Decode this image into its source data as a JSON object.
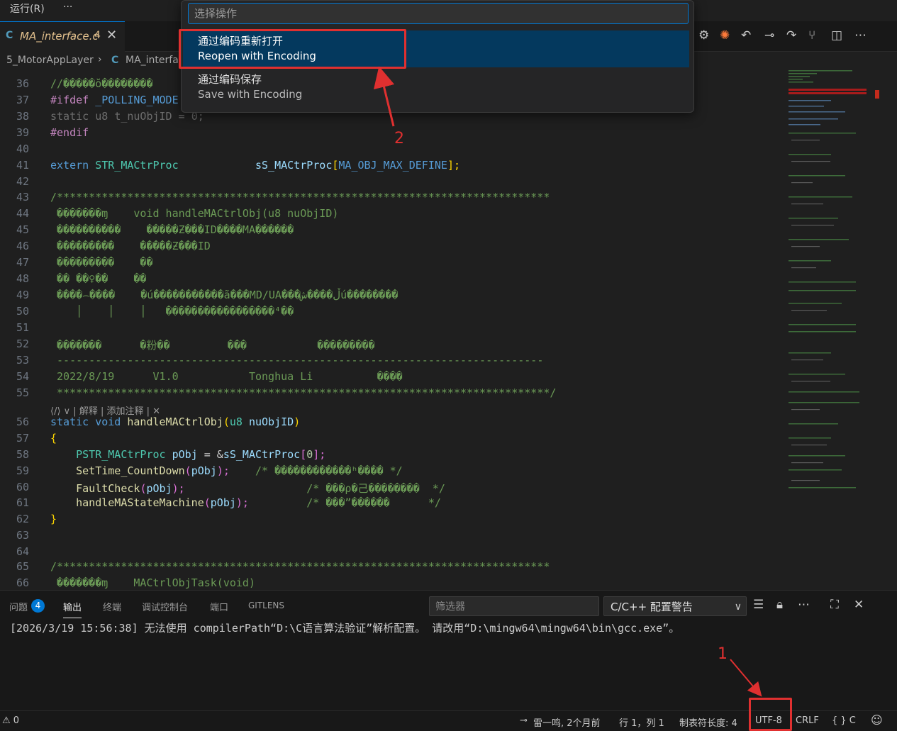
{
  "menubar": {
    "run_label": "运行(R)",
    "more_label": "···"
  },
  "tab": {
    "lang": "C",
    "name": "MA_interface.c",
    "problems": "4",
    "close": "✕"
  },
  "toolbar_icons": [
    "settings-icon",
    "sparkle-icon",
    "go-back-icon",
    "git-commit-icon",
    "go-forward-icon",
    "graph-icon",
    "split-editor-icon",
    "more-icon"
  ],
  "breadcrumb": {
    "folder": "5_MotorAppLayer",
    "sep": "›",
    "lang": "C",
    "file": "MA_interface.c"
  },
  "quick_pick": {
    "placeholder": "选择操作",
    "items": [
      {
        "label": "通过编码重新打开",
        "detail": "Reopen with Encoding"
      },
      {
        "label": "通过编码保存",
        "detail": "Save with Encoding"
      }
    ]
  },
  "annotations": {
    "one": "1",
    "two": "2"
  },
  "editor": {
    "line_numbers": [
      "36",
      "37",
      "38",
      "39",
      "40",
      "41",
      "42",
      "43",
      "44",
      "45",
      "46",
      "47",
      "48",
      "49",
      "50",
      "51",
      "52",
      "53",
      "54",
      "55",
      "56",
      "57",
      "58",
      "59",
      "60",
      "61",
      "62",
      "63",
      "64",
      "65",
      "66"
    ],
    "codelens": "⟨/⟩ ∨ | 解释 | 添加注释 | ✕",
    "code": {
      "l36": "//�����ŏ��������",
      "l37a": "#ifdef",
      "l37b": " _POLLING_MODE",
      "l38a": "static",
      "l38b": " u8 ",
      "l38c": "t_nuObjID",
      "l38d": " = ",
      "l38e": "0",
      "l38f": ";",
      "l39": "#endif",
      "l41a": "extern",
      "l41b": " STR_MACtrProc",
      "l41c": "            sS_MACtrProc",
      "l41d": "[",
      "l41e": "MA_OBJ_MAX_DEFINE",
      "l41f": "];",
      "l43": "/*****************************************************************************",
      "l44": " �������ɱ    void handleMACtrlObj(u8 nuObjID)",
      "l45": " ����������    �����Ƶ���ID����MA������",
      "l46": " ���������    �����Ƶ���ID",
      "l47": " ���������    ��",
      "l48": " �� ��♀��    ��",
      "l49": " ����⌢����    �ú�����������ã���MD/UA���ڵ����شú��������",
      "l50": "    │    │    │   �����������������⁴��",
      "l52": " �������      �粉��         ���           ���������",
      "l53": " ----------------------------------------------------------------------------",
      "l54": " 2022/8/19      V1.0           Tonghua Li          ����",
      "l55": " *****************************************************************************/",
      "l56a": "static",
      "l56b": " void",
      "l56c": " handleMACtrlObj",
      "l56d": "(",
      "l56e": "u8",
      "l56f": " nuObjID",
      "l56g": ")",
      "l57": "{",
      "l58a": "    PSTR_MACtrProc",
      "l58b": " pObj",
      "l58c": " = &",
      "l58d": "sS_MACtrProc",
      "l58e": "[",
      "l58f": "0",
      "l58g": "];",
      "l59a": "    SetTime_CountDown",
      "l59b": "(",
      "l59c": "pObj",
      "l59d": ");",
      "l59e": "    /* ������������ʰ���� */",
      "l60a": "    FaultCheck",
      "l60b": "(",
      "l60c": "pObj",
      "l60d": ");",
      "l60e": "                   /* ���ρ�己��������  */",
      "l61a": "    handleMAStateMachine",
      "l61b": "(",
      "l61c": "pObj",
      "l61d": ");",
      "l61e": "         /* ���ˮ������      */",
      "l62": "}",
      "l65": "/*****************************************************************************",
      "l66": " �������ɱ    MACtrlObjTask(void)"
    }
  },
  "panel": {
    "tabs": {
      "problems": "问题",
      "problems_count": "4",
      "output": "输出",
      "terminal": "终端",
      "debug_console": "调试控制台",
      "ports": "端口",
      "gitlens": "GITLENS"
    },
    "filter_placeholder": "筛选器",
    "channel": "C/C++ 配置警告",
    "output_line": "[2026/3/19 15:56:38] 无法使用 compilerPath“D:\\C语言算法验证”解析配置。 请改用“D:\\mingw64\\mingw64\\bin\\gcc.exe”。"
  },
  "statusbar": {
    "problems": "⚠ 0",
    "blame": "雷一鸣, 2个月前",
    "position": "行 1，列 1",
    "tab_size": "制表符长度: 4",
    "encoding": "UTF-8",
    "eol": "CRLF",
    "lang": "{ } C"
  }
}
